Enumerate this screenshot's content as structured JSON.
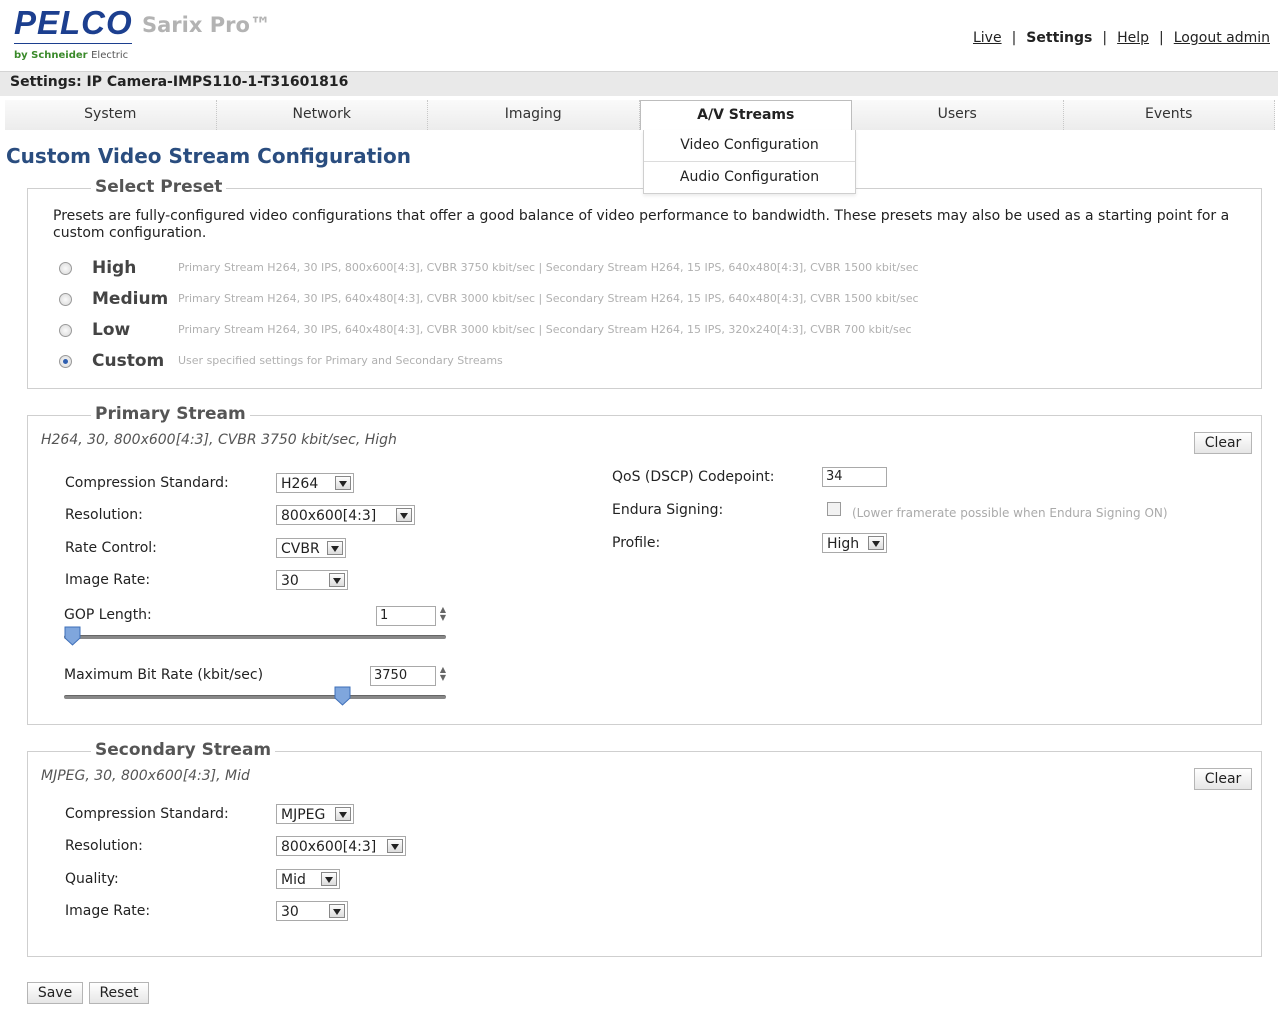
{
  "header": {
    "brand": "PELCO",
    "product": "Sarix Pro™",
    "byline_brand": "by Schneider",
    "byline_sub": "Electric",
    "nav": [
      {
        "label": "Live"
      },
      {
        "label": "Settings"
      },
      {
        "label": "Help"
      },
      {
        "label": "Logout admin"
      }
    ],
    "nav_separator": "|"
  },
  "settings_title": "Settings: IP Camera-IMPS110-1-T31601816",
  "tabs": [
    "System",
    "Network",
    "Imaging",
    "A/V Streams",
    "Users",
    "Events"
  ],
  "active_tab": "A/V Streams",
  "submenu": [
    "Video Configuration",
    "Audio Configuration"
  ],
  "page_title": "Custom Video Stream Configuration",
  "preset": {
    "legend": "Select Preset",
    "intro": "Presets are fully-configured video configurations that offer a good balance of video performance to bandwidth. These presets may also be used as a starting point for a custom configuration.",
    "options": [
      {
        "name": "High",
        "desc": "Primary Stream H264, 30 IPS, 800x600[4:3], CVBR 3750 kbit/sec | Secondary Stream H264, 15 IPS, 640x480[4:3], CVBR 1500 kbit/sec"
      },
      {
        "name": "Medium",
        "desc": "Primary Stream H264, 30 IPS, 640x480[4:3], CVBR 3000 kbit/sec | Secondary Stream H264, 15 IPS, 640x480[4:3], CVBR 1500 kbit/sec"
      },
      {
        "name": "Low",
        "desc": "Primary Stream H264, 30 IPS, 640x480[4:3], CVBR 3000 kbit/sec | Secondary Stream H264, 15 IPS, 320x240[4:3], CVBR 700 kbit/sec"
      },
      {
        "name": "Custom",
        "desc": "User specified settings for Primary and Secondary Streams"
      }
    ],
    "selected": "Custom"
  },
  "primary": {
    "legend": "Primary Stream",
    "summary": "H264, 30, 800x600[4:3], CVBR 3750 kbit/sec, High",
    "clear_label": "Clear",
    "compression_label": "Compression Standard:",
    "compression_value": "H264",
    "resolution_label": "Resolution:",
    "resolution_value": "800x600[4:3]",
    "rate_control_label": "Rate Control:",
    "rate_control_value": "CVBR",
    "image_rate_label": "Image Rate:",
    "image_rate_value": "30",
    "gop_label": "GOP Length:",
    "gop_value": "1",
    "gop_slider_fraction": 0.0,
    "max_bitrate_label": "Maximum Bit Rate (kbit/sec)",
    "max_bitrate_value": "3750",
    "bitrate_slider_fraction": 0.74,
    "qos_label": "QoS (DSCP) Codepoint:",
    "qos_value": "34",
    "endura_label": "Endura Signing:",
    "endura_note": "(Lower framerate possible when Endura Signing ON)",
    "endura_checked": false,
    "profile_label": "Profile:",
    "profile_value": "High"
  },
  "secondary": {
    "legend": "Secondary Stream",
    "summary": "MJPEG, 30, 800x600[4:3], Mid",
    "clear_label": "Clear",
    "compression_label": "Compression Standard:",
    "compression_value": "MJPEG",
    "resolution_label": "Resolution:",
    "resolution_value": "800x600[4:3]",
    "quality_label": "Quality:",
    "quality_value": "Mid",
    "image_rate_label": "Image Rate:",
    "image_rate_value": "30"
  },
  "actions": {
    "save_label": "Save",
    "reset_label": "Reset"
  },
  "colors": {
    "brand_blue": "#1c3f8f",
    "title_blue": "#2a4d7f",
    "radio_selected": "#2f5fb0"
  }
}
